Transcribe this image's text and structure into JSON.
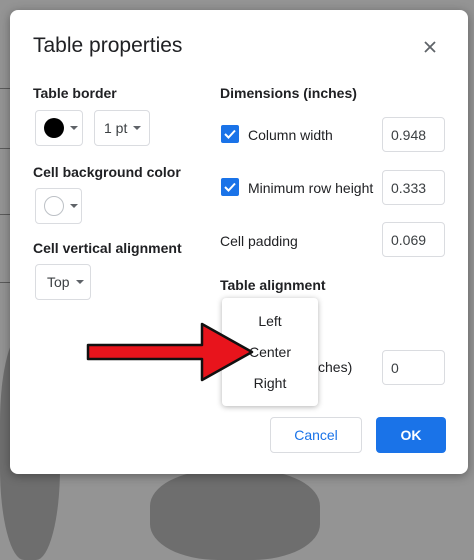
{
  "dialog": {
    "title": "Table properties",
    "close_icon": "close-icon"
  },
  "table_border": {
    "label": "Table border",
    "color": "#000000",
    "width_value": "1 pt"
  },
  "cell_background": {
    "label": "Cell background color",
    "color": "#ffffff"
  },
  "cell_vertical_alignment": {
    "label": "Cell vertical alignment",
    "value": "Top"
  },
  "dimensions": {
    "label": "Dimensions  (inches)",
    "column_width": {
      "label": "Column width",
      "checked": true,
      "value": "0.948"
    },
    "min_row_height": {
      "label": "Minimum row height",
      "checked": true,
      "value": "0.333"
    },
    "cell_padding": {
      "label": "Cell padding",
      "value": "0.069"
    }
  },
  "table_alignment": {
    "label": "Table alignment",
    "options": [
      "Left",
      "Center",
      "Right"
    ],
    "partial_hidden_label": "ches)",
    "indent_value": "0"
  },
  "buttons": {
    "cancel": "Cancel",
    "ok": "OK"
  },
  "colors": {
    "accent": "#1a73e8",
    "annotation_arrow": "#e8141c"
  }
}
